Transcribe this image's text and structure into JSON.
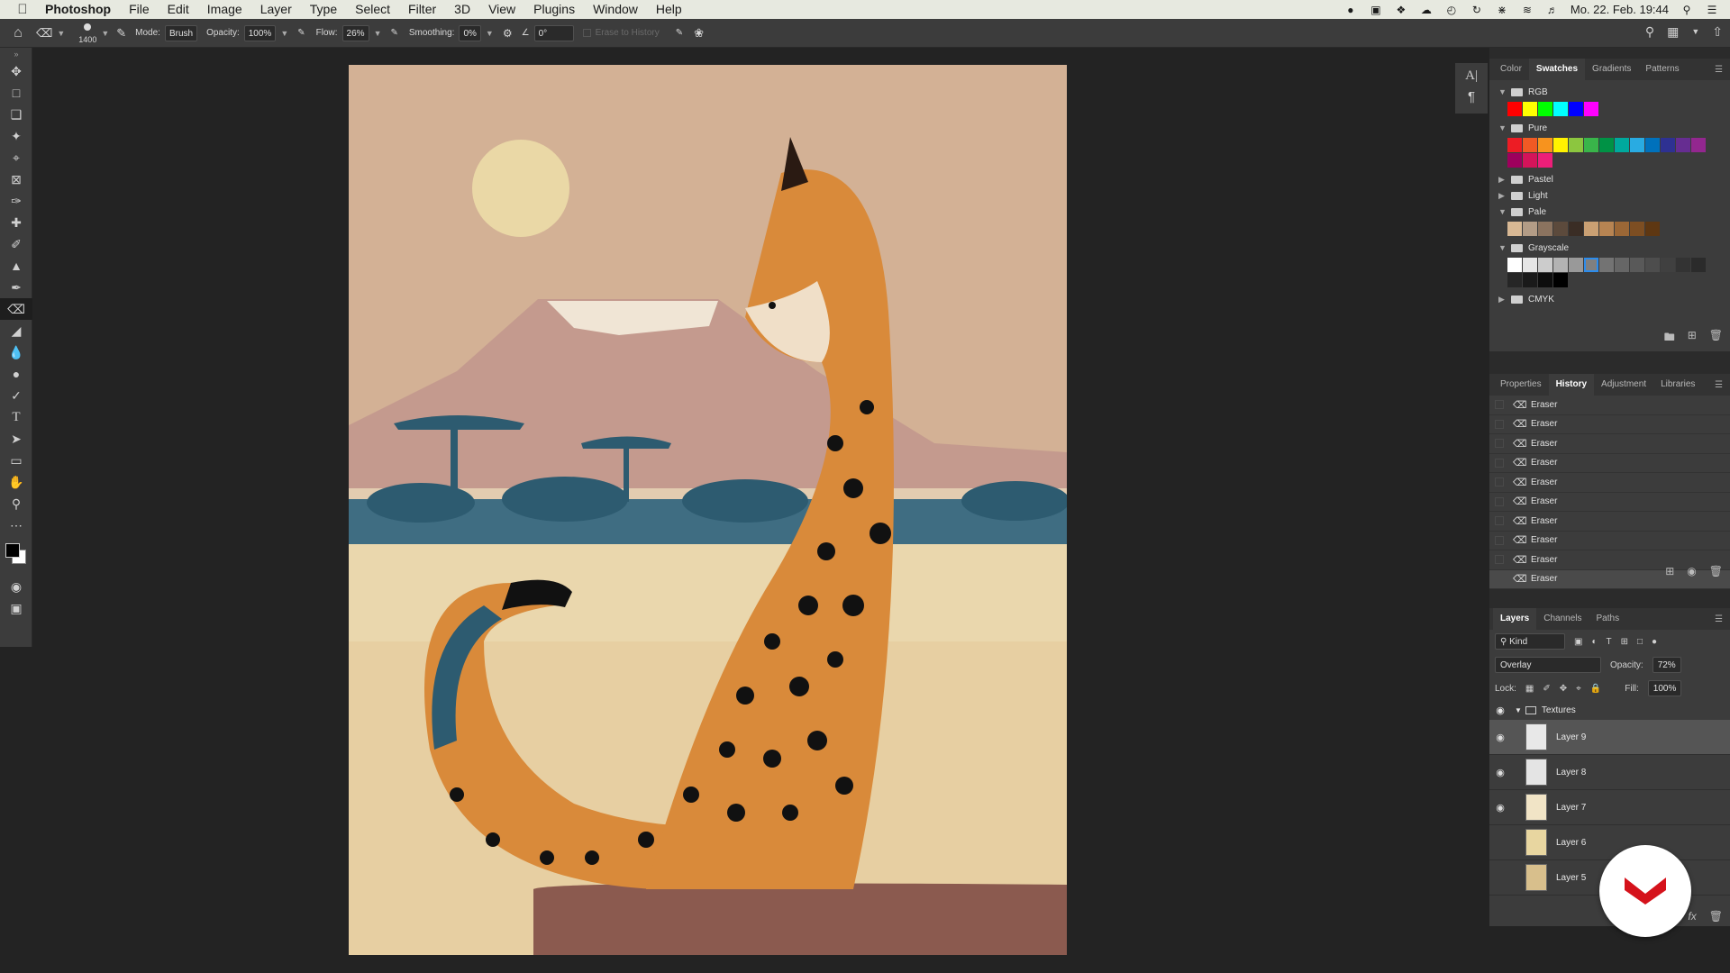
{
  "menubar": {
    "app_name": "Photoshop",
    "items": [
      "File",
      "Edit",
      "Image",
      "Layer",
      "Type",
      "Select",
      "Filter",
      "3D",
      "View",
      "Plugins",
      "Window",
      "Help"
    ],
    "datetime": "Mo. 22. Feb. 19:44"
  },
  "options": {
    "brush_size": "1400",
    "mode_label": "Mode:",
    "mode_value": "Brush",
    "opacity_label": "Opacity:",
    "opacity_value": "100%",
    "flow_label": "Flow:",
    "flow_value": "26%",
    "smoothing_label": "Smoothing:",
    "smoothing_value": "0%",
    "angle_value": "0°",
    "erase_history_label": "Erase to History"
  },
  "tools": [
    "move-tool",
    "marquee-tool",
    "lasso-tool",
    "magic-wand-tool",
    "crop-tool",
    "frame-tool",
    "eyedropper-tool",
    "healing-brush-tool",
    "brush-tool",
    "clone-stamp-tool",
    "history-brush-tool",
    "eraser-tool",
    "paint-bucket-tool",
    "blur-tool",
    "dodge-tool",
    "pen-tool",
    "type-tool",
    "path-selection-tool",
    "rectangle-tool",
    "hand-tool",
    "zoom-tool",
    "more-tools"
  ],
  "swatches_panel": {
    "tabs": [
      "Color",
      "Swatches",
      "Gradients",
      "Patterns"
    ],
    "active_tab": "Swatches",
    "groups": [
      {
        "name": "RGB",
        "open": true,
        "colors": [
          "#ff0000",
          "#ffff00",
          "#00ff00",
          "#00ffff",
          "#0000ff",
          "#ff00ff"
        ]
      },
      {
        "name": "Pure",
        "open": true,
        "colors": [
          "#ed1c24",
          "#f15a24",
          "#f7931e",
          "#fff200",
          "#8cc63f",
          "#39b54a",
          "#009245",
          "#00a99d",
          "#29abe2",
          "#0071bc",
          "#2e3192",
          "#662d91",
          "#93278f",
          "#9e005d",
          "#d4145a",
          "#ed1e79"
        ]
      },
      {
        "name": "Pastel",
        "open": false,
        "colors": []
      },
      {
        "name": "Light",
        "open": false,
        "colors": []
      },
      {
        "name": "Pale",
        "open": true,
        "colors": [
          "#d8b894",
          "#b39c86",
          "#8b735f",
          "#5c4a3c",
          "#3a2d25",
          "#caa073",
          "#b78452",
          "#9b6736",
          "#7d4e22",
          "#5e3712"
        ]
      },
      {
        "name": "Grayscale",
        "open": true,
        "colors": [
          "#ffffff",
          "#e6e6e6",
          "#cccccc",
          "#b3b3b3",
          "#999999",
          "#808080",
          "#737373",
          "#666666",
          "#595959",
          "#4d4d4d",
          "#404040",
          "#333333",
          "#2b2b2b",
          "#262626",
          "#1a1a1a",
          "#0d0d0d",
          "#000000"
        ]
      },
      {
        "name": "CMYK",
        "open": false,
        "colors": []
      }
    ]
  },
  "history_panel": {
    "tabs": [
      "Properties",
      "History",
      "Adjustment",
      "Libraries"
    ],
    "active_tab": "History",
    "items": [
      "Eraser",
      "Eraser",
      "Eraser",
      "Eraser",
      "Eraser",
      "Eraser",
      "Eraser",
      "Eraser",
      "Eraser",
      "Eraser"
    ]
  },
  "layers_panel": {
    "tabs": [
      "Layers",
      "Channels",
      "Paths"
    ],
    "active_tab": "Layers",
    "filter_label": "Kind",
    "blend_mode": "Overlay",
    "opacity_label": "Opacity:",
    "opacity_value": "72%",
    "lock_label": "Lock:",
    "fill_label": "Fill:",
    "fill_value": "100%",
    "group_name": "Textures",
    "layers": [
      {
        "name": "Layer 9",
        "visible": true,
        "selected": true,
        "thumb": "#e8e8e8"
      },
      {
        "name": "Layer 8",
        "visible": true,
        "selected": false,
        "thumb": "#e4e4e4"
      },
      {
        "name": "Layer 7",
        "visible": true,
        "selected": false,
        "thumb": "#f1e4c6"
      },
      {
        "name": "Layer 6",
        "visible": false,
        "selected": false,
        "thumb": "#e8d6a0"
      },
      {
        "name": "Layer 5",
        "visible": false,
        "selected": false,
        "thumb": "#d8bf8c"
      }
    ]
  },
  "colors": {
    "accent_selection": "#2d8ceb",
    "badge_logo": "#d5121b"
  }
}
